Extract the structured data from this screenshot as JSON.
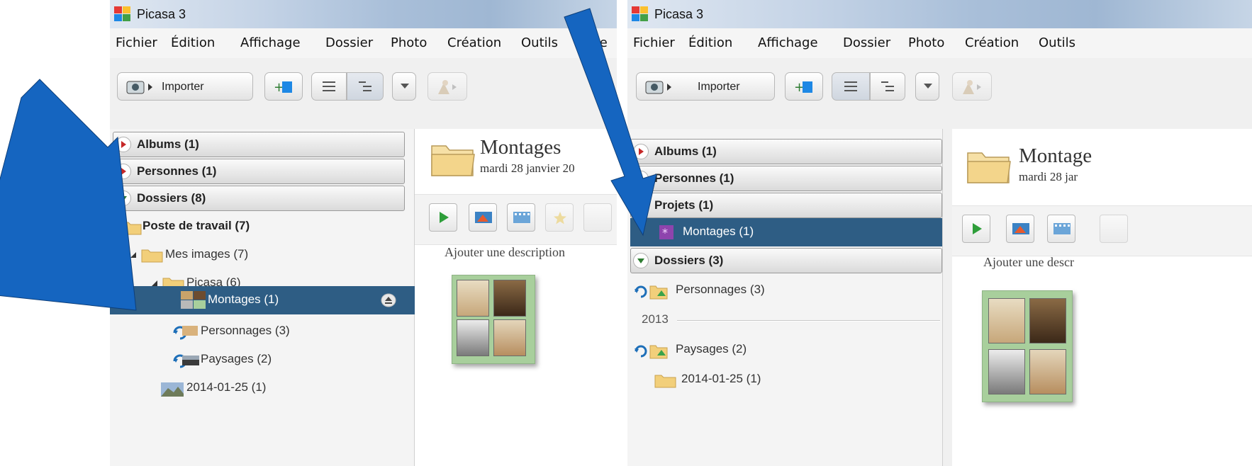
{
  "app": {
    "title": "Picasa 3"
  },
  "menu": {
    "fichier": "Fichier",
    "edition": "Édition",
    "affichage": "Affichage",
    "dossier": "Dossier",
    "photo": "Photo",
    "creation": "Création",
    "outils": "Outils",
    "aide_partial": "Aide"
  },
  "toolbar": {
    "import_label": "Importer"
  },
  "left": {
    "sections": {
      "albums": "Albums (1)",
      "personnes": "Personnes (1)",
      "dossiers": "Dossiers (8)"
    },
    "tree": {
      "poste": "Poste de travail (7)",
      "mes_images": "Mes images (7)",
      "picasa": "Picasa (6)",
      "montages": "Montages (1)",
      "personnages": "Personnages (3)",
      "paysages": "Paysages (2)",
      "date_folder": "2014-01-25 (1)"
    },
    "content": {
      "title": "Montages",
      "date": "mardi 28 janvier 20",
      "description": "Ajouter une description"
    }
  },
  "right": {
    "sections": {
      "albums": "Albums (1)",
      "personnes": "Personnes (1)",
      "projets": "Projets (1)",
      "dossiers": "Dossiers (3)"
    },
    "tree": {
      "montages": "Montages (1)",
      "personnages": "Personnages (3)",
      "year": "2013",
      "paysages": "Paysages (2)",
      "date_folder": "2014-01-25 (1)"
    },
    "content": {
      "title": "Montage",
      "date": "mardi 28 jar",
      "description": "Ajouter une descr"
    }
  },
  "colors": {
    "selection": "#2e5d84",
    "arrow": "#1565c0",
    "thumb_border": "#a8cf9c"
  }
}
